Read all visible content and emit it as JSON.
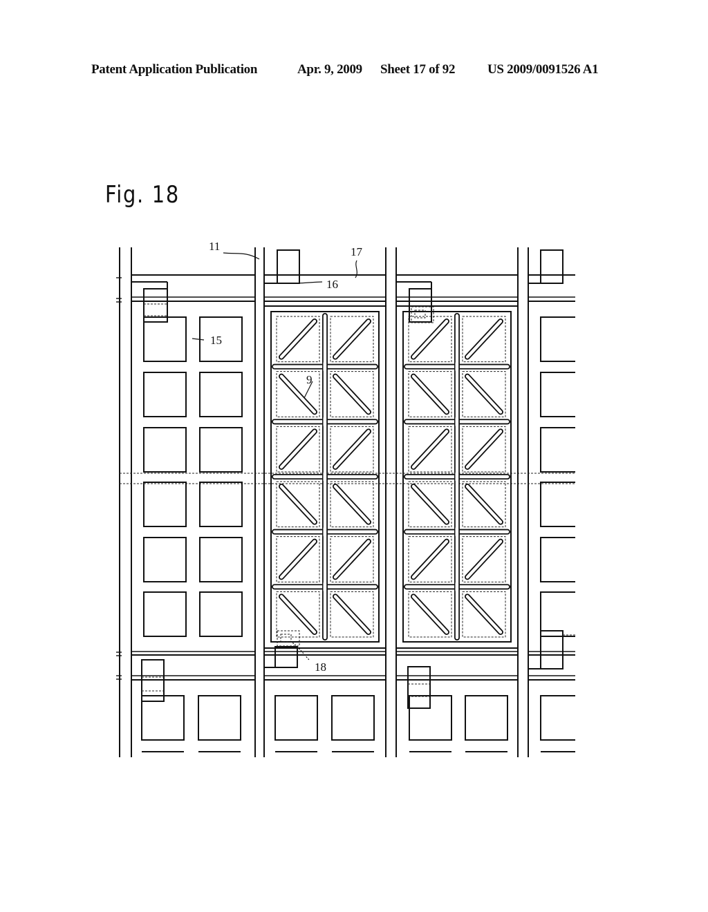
{
  "header": {
    "publication": "Patent Application Publication",
    "date": "Apr. 9, 2009",
    "sheet": "Sheet 17 of 92",
    "number": "US 2009/0091526 A1"
  },
  "figure": {
    "title": "Fig. 18",
    "labels": [
      {
        "id": "11",
        "text": "11"
      },
      {
        "id": "15",
        "text": "15"
      },
      {
        "id": "16",
        "text": "16"
      },
      {
        "id": "17",
        "text": "17"
      },
      {
        "id": "9",
        "text": "9"
      },
      {
        "id": "18",
        "text": "18"
      }
    ],
    "pixel_columns": 4,
    "subpixel_rows": 6,
    "slit_orientation_rows": [
      "/",
      "\\",
      "/",
      "\\",
      "/",
      "\\"
    ]
  }
}
